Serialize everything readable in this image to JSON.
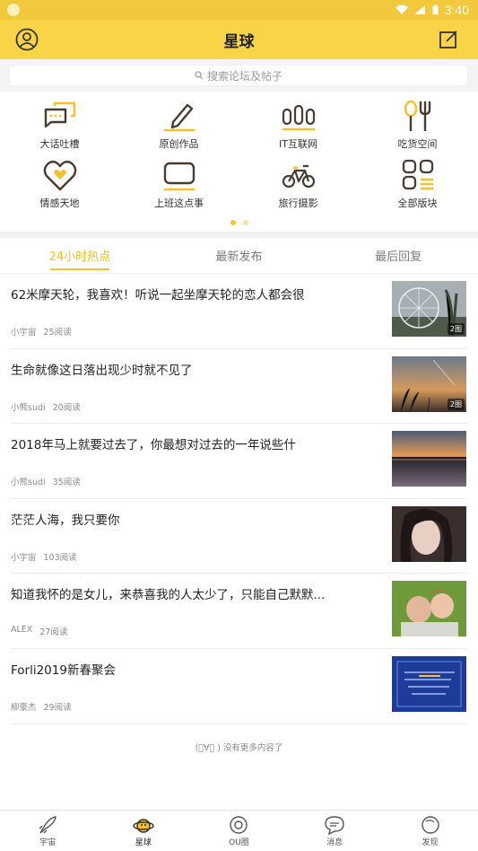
{
  "status_bar": {
    "time": "3:40"
  },
  "header": {
    "title": "星球"
  },
  "search": {
    "placeholder": "搜索论坛及帖子"
  },
  "categories": [
    {
      "label": "大话吐槽",
      "icon": "chat-bubbles-icon"
    },
    {
      "label": "原创作品",
      "icon": "pencil-icon"
    },
    {
      "label": "IT互联网",
      "icon": "network-icon"
    },
    {
      "label": "吃货空间",
      "icon": "fork-spoon-icon"
    },
    {
      "label": "情感天地",
      "icon": "heart-icon"
    },
    {
      "label": "上班这点事",
      "icon": "briefcase-icon"
    },
    {
      "label": "旅行摄影",
      "icon": "bicycle-icon"
    },
    {
      "label": "全部版块",
      "icon": "grid-icon"
    }
  ],
  "tabs": [
    {
      "label": "24小时热点"
    },
    {
      "label": "最新发布"
    },
    {
      "label": "最后回复"
    }
  ],
  "posts": [
    {
      "title": "62米摩天轮，我喜欢！听说一起坐摩天轮的恋人都会很",
      "author": "小宇宙",
      "reads": "25阅读",
      "badge": "2图"
    },
    {
      "title": "生命就像这日落出现少时就不见了",
      "author": "小熊sudi",
      "reads": "20阅读",
      "badge": "2图"
    },
    {
      "title": "2018年马上就要过去了，你最想对过去的一年说些什",
      "author": "小熊sudi",
      "reads": "35阅读",
      "badge": ""
    },
    {
      "title": "茫茫人海，我只要你",
      "author": "小宇宙",
      "reads": "103阅读",
      "badge": ""
    },
    {
      "title": "知道我怀的是女儿，来恭喜我的人太少了，只能自己默默...",
      "author": "ALEX",
      "reads": "27阅读",
      "badge": ""
    },
    {
      "title": "Forli2019新春聚会",
      "author": "柳豪杰",
      "reads": "29阅读",
      "badge": ""
    }
  ],
  "end_note": "(ﾟ∀ﾟ ) 没有更多内容了",
  "bottom_nav": [
    {
      "label": "宇宙"
    },
    {
      "label": "星球"
    },
    {
      "label": "OU圈"
    },
    {
      "label": "消息"
    },
    {
      "label": "发现"
    }
  ],
  "colors": {
    "accent": "#f9d447",
    "tab_active": "#f5c02a"
  }
}
